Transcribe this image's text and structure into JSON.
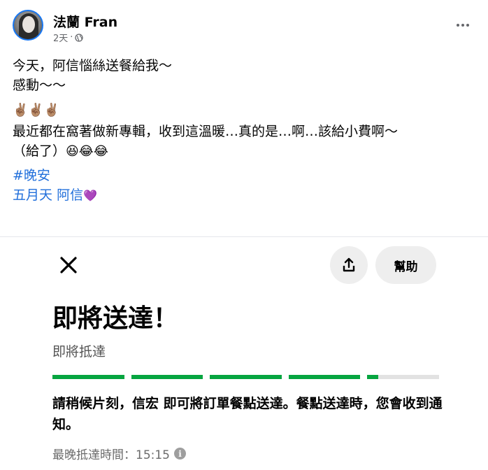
{
  "post": {
    "author": "法蘭 Fran",
    "time": "2天",
    "dot": "·",
    "lines": [
      "今天，阿信惱絲送餐給我～",
      "感動～～"
    ],
    "emoji_line": "✌🏽✌🏽✌🏽",
    "body_line1": "最近都在窩著做新專輯，收到這溫暖…真的是…啊…該給小費啊～",
    "body_line2": "（給了）",
    "laugh_emoji": "😆😂😂",
    "hashtag": "#晚安",
    "tag1": "五月天",
    "tag2": "阿信",
    "heart": "💜"
  },
  "receipt": {
    "help_label": "幫助",
    "title": "即將送達！",
    "subtitle": "即將抵達",
    "progress_segments": [
      1,
      1,
      1,
      1,
      0.15
    ],
    "message": "請稍候片刻，信宏 即可將訂單餐點送達。餐點送達時，您會收到通知。",
    "eta_label": "最晚抵達時間：15:15",
    "info_glyph": "i",
    "accent_color": "#06a540"
  }
}
